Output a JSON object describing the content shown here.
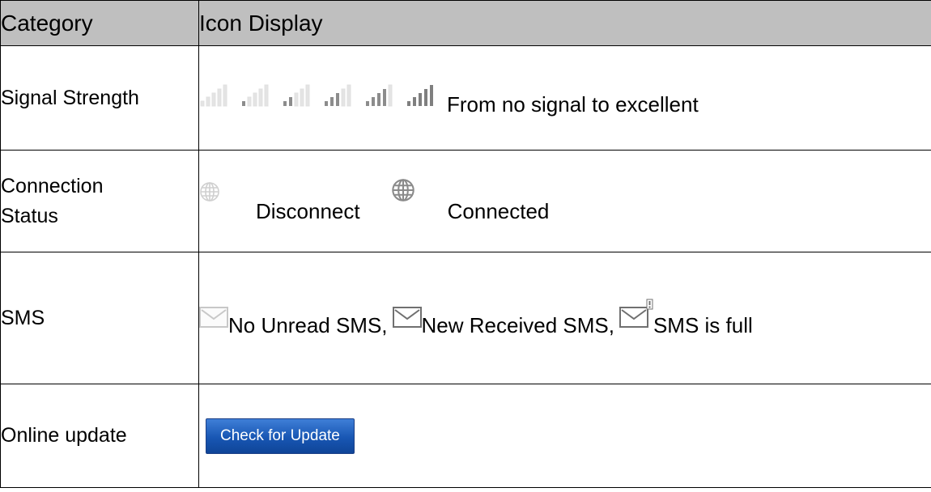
{
  "header": {
    "category": "Category",
    "icon_display": "Icon Display"
  },
  "rows": [
    {
      "category": "Signal Strength",
      "levels": 6,
      "description": "From no signal to excellent",
      "icon": "signal-bars-icon"
    },
    {
      "category_line1": "Connection",
      "category_line2": "Status",
      "disconnect": "Disconnect",
      "connected": "Connected",
      "icon": "globe-icon"
    },
    {
      "category": "SMS",
      "no_unread": "No Unread SMS,",
      "new_received": "New Received SMS,",
      "full": "SMS is full",
      "icon": "envelope-icon"
    },
    {
      "category": "Online update",
      "button": "Check for Update",
      "button_color": "#1f5fbf"
    }
  ]
}
